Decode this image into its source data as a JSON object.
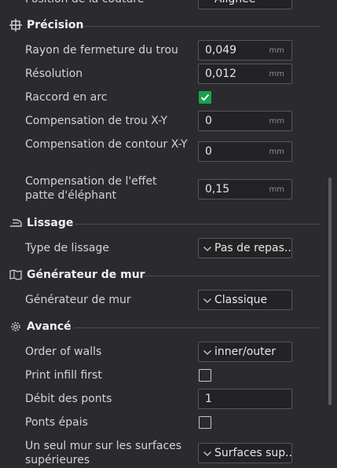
{
  "top_partial": {
    "label": "Position de la couture",
    "value": "Alignée"
  },
  "sections": {
    "precision": {
      "title": "Précision"
    },
    "lissage": {
      "title": "Lissage"
    },
    "generateur": {
      "title": "Générateur de mur"
    },
    "avance": {
      "title": "Avancé"
    }
  },
  "icons": {
    "precision": "crosshair-icon",
    "lissage": "iron-icon",
    "generateur": "wall-generator-icon",
    "avance": "gear-icon",
    "combo": "chevron-down-icon",
    "check": "checkmark-icon"
  },
  "precision_rows": {
    "rayon": {
      "label": "Rayon de fermeture du trou",
      "value": "0,049",
      "unit": "mm"
    },
    "resolution": {
      "label": "Résolution",
      "value": "0,012",
      "unit": "mm"
    },
    "raccord": {
      "label": "Raccord en arc",
      "checked": true
    },
    "comp_trou": {
      "label": "Compensation de trou X-Y",
      "value": "0",
      "unit": "mm"
    },
    "comp_contour": {
      "label": "Compensation de contour X-Y",
      "value": "0",
      "unit": "mm"
    },
    "comp_elephant": {
      "label": "Compensation de l'effet patte d'éléphant",
      "value": "0,15",
      "unit": "mm"
    }
  },
  "lissage_rows": {
    "type": {
      "label": "Type de lissage",
      "value": "Pas de repas..."
    }
  },
  "generateur_rows": {
    "gen": {
      "label": "Générateur de mur",
      "value": "Classique"
    }
  },
  "avance_rows": {
    "order": {
      "label": "Order of walls",
      "value": "inner/outer"
    },
    "infill_first": {
      "label": "Print infill first",
      "checked": false
    },
    "debit": {
      "label": "Débit des ponts",
      "value": "1"
    },
    "ponts_epais": {
      "label": "Ponts épais",
      "checked": false
    },
    "seul_mur": {
      "label": "Un seul mur sur les surfaces supérieures",
      "value": "Surfaces sup..."
    }
  },
  "colors": {
    "background": "#2b2b2f",
    "checkbox_on": "#16a34a",
    "field_border": "#57575c"
  }
}
